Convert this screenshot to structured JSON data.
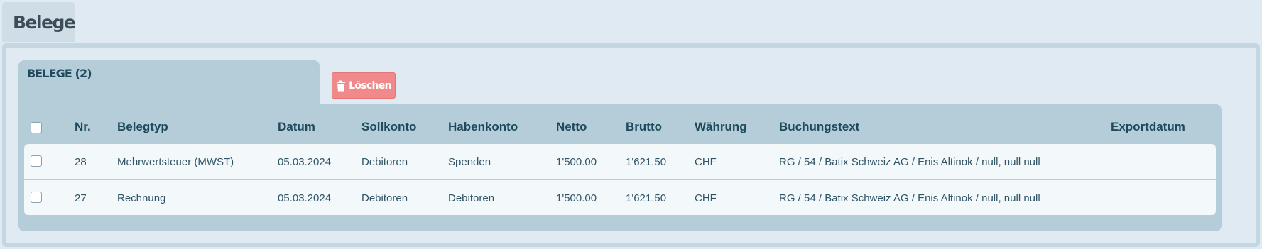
{
  "page": {
    "tab_title": "Belege"
  },
  "list": {
    "tab_title": "BELEGE (2)",
    "delete_label": "Löschen",
    "delete_icon": "trash-icon",
    "columns": {
      "nr": "Nr.",
      "belegtyp": "Belegtyp",
      "datum": "Datum",
      "sollkonto": "Sollkonto",
      "habenkonto": "Habenkonto",
      "netto": "Netto",
      "brutto": "Brutto",
      "waehrung": "Währung",
      "buchungstext": "Buchungstext",
      "exportdatum": "Exportdatum"
    },
    "rows": [
      {
        "nr": "28",
        "belegtyp": "Mehrwertsteuer (MWST)",
        "datum": "05.03.2024",
        "sollkonto": "Debitoren",
        "habenkonto": "Spenden",
        "netto": "1'500.00",
        "brutto": "1'621.50",
        "waehrung": "CHF",
        "buchungstext": "RG / 54 / Batix Schweiz AG / Enis Altinok / null, null null",
        "exportdatum": ""
      },
      {
        "nr": "27",
        "belegtyp": "Rechnung",
        "datum": "05.03.2024",
        "sollkonto": "Debitoren",
        "habenkonto": "Debitoren",
        "netto": "1'500.00",
        "brutto": "1'621.50",
        "waehrung": "CHF",
        "buchungstext": "RG / 54 / Batix Schweiz AG / Enis Altinok / null, null null",
        "exportdatum": ""
      }
    ]
  },
  "colors": {
    "background": "#dfeaf3",
    "panel": "#b4cdd9",
    "delete_button": "#f08a8a",
    "text": "#1f4a5e"
  }
}
